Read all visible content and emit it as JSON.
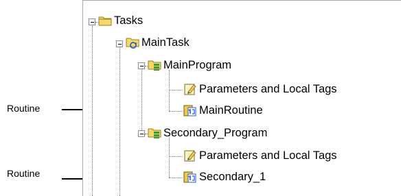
{
  "tree": {
    "tasks": {
      "label": "Tasks",
      "icon": "folder-icon"
    },
    "main_task": {
      "label": "MainTask",
      "icon": "task-icon"
    },
    "main_program": {
      "label": "MainProgram",
      "icon": "program-icon"
    },
    "mp_params": {
      "label": "Parameters and Local Tags",
      "icon": "tags-icon"
    },
    "main_routine": {
      "label": "MainRoutine",
      "icon": "routine-icon"
    },
    "secondary_prog": {
      "label": "Secondary_Program",
      "icon": "program-icon"
    },
    "sp_params": {
      "label": "Parameters and Local Tags",
      "icon": "tags-icon"
    },
    "secondary_1": {
      "label": "Secondary_1",
      "icon": "routine-icon"
    }
  },
  "callouts": {
    "first": "Routine",
    "second": "Routine"
  },
  "colors": {
    "folder": "#f4d96a",
    "folder_edge": "#a07c1e",
    "program_green": "#3c9a3c",
    "routine_yellow": "#f2c84b",
    "routine_blue": "#2a5fc4"
  }
}
